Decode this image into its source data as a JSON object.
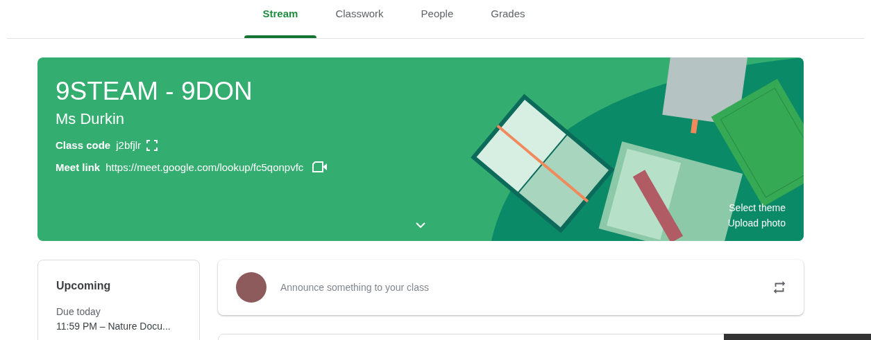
{
  "tabs": [
    {
      "label": "Stream",
      "selected": true
    },
    {
      "label": "Classwork",
      "selected": false
    },
    {
      "label": "People",
      "selected": false
    },
    {
      "label": "Grades",
      "selected": false
    }
  ],
  "banner": {
    "title": "9STEAM - 9DON",
    "teacher": "Ms Durkin",
    "class_code_label": "Class code",
    "class_code": "j2bfjlr",
    "meet_link_label": "Meet link",
    "meet_link": "https://meet.google.com/lookup/fc5qonpvfc",
    "actions": [
      "Select theme",
      "Upload photo"
    ]
  },
  "upcoming": {
    "title": "Upcoming",
    "due_label": "Due today",
    "items": [
      "11:59 PM – Nature Docu..."
    ]
  },
  "announce": {
    "placeholder": "Announce something to your class"
  }
}
